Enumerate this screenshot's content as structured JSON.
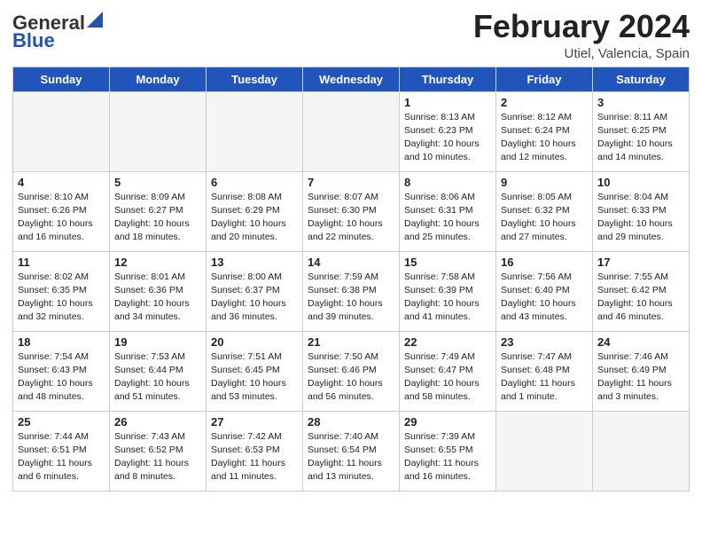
{
  "header": {
    "logo_general": "General",
    "logo_blue": "Blue",
    "title": "February 2024",
    "subtitle": "Utiel, Valencia, Spain"
  },
  "days_of_week": [
    "Sunday",
    "Monday",
    "Tuesday",
    "Wednesday",
    "Thursday",
    "Friday",
    "Saturday"
  ],
  "weeks": [
    [
      {
        "day": "",
        "info": ""
      },
      {
        "day": "",
        "info": ""
      },
      {
        "day": "",
        "info": ""
      },
      {
        "day": "",
        "info": ""
      },
      {
        "day": "1",
        "info": "Sunrise: 8:13 AM\nSunset: 6:23 PM\nDaylight: 10 hours and 10 minutes."
      },
      {
        "day": "2",
        "info": "Sunrise: 8:12 AM\nSunset: 6:24 PM\nDaylight: 10 hours and 12 minutes."
      },
      {
        "day": "3",
        "info": "Sunrise: 8:11 AM\nSunset: 6:25 PM\nDaylight: 10 hours and 14 minutes."
      }
    ],
    [
      {
        "day": "4",
        "info": "Sunrise: 8:10 AM\nSunset: 6:26 PM\nDaylight: 10 hours and 16 minutes."
      },
      {
        "day": "5",
        "info": "Sunrise: 8:09 AM\nSunset: 6:27 PM\nDaylight: 10 hours and 18 minutes."
      },
      {
        "day": "6",
        "info": "Sunrise: 8:08 AM\nSunset: 6:29 PM\nDaylight: 10 hours and 20 minutes."
      },
      {
        "day": "7",
        "info": "Sunrise: 8:07 AM\nSunset: 6:30 PM\nDaylight: 10 hours and 22 minutes."
      },
      {
        "day": "8",
        "info": "Sunrise: 8:06 AM\nSunset: 6:31 PM\nDaylight: 10 hours and 25 minutes."
      },
      {
        "day": "9",
        "info": "Sunrise: 8:05 AM\nSunset: 6:32 PM\nDaylight: 10 hours and 27 minutes."
      },
      {
        "day": "10",
        "info": "Sunrise: 8:04 AM\nSunset: 6:33 PM\nDaylight: 10 hours and 29 minutes."
      }
    ],
    [
      {
        "day": "11",
        "info": "Sunrise: 8:02 AM\nSunset: 6:35 PM\nDaylight: 10 hours and 32 minutes."
      },
      {
        "day": "12",
        "info": "Sunrise: 8:01 AM\nSunset: 6:36 PM\nDaylight: 10 hours and 34 minutes."
      },
      {
        "day": "13",
        "info": "Sunrise: 8:00 AM\nSunset: 6:37 PM\nDaylight: 10 hours and 36 minutes."
      },
      {
        "day": "14",
        "info": "Sunrise: 7:59 AM\nSunset: 6:38 PM\nDaylight: 10 hours and 39 minutes."
      },
      {
        "day": "15",
        "info": "Sunrise: 7:58 AM\nSunset: 6:39 PM\nDaylight: 10 hours and 41 minutes."
      },
      {
        "day": "16",
        "info": "Sunrise: 7:56 AM\nSunset: 6:40 PM\nDaylight: 10 hours and 43 minutes."
      },
      {
        "day": "17",
        "info": "Sunrise: 7:55 AM\nSunset: 6:42 PM\nDaylight: 10 hours and 46 minutes."
      }
    ],
    [
      {
        "day": "18",
        "info": "Sunrise: 7:54 AM\nSunset: 6:43 PM\nDaylight: 10 hours and 48 minutes."
      },
      {
        "day": "19",
        "info": "Sunrise: 7:53 AM\nSunset: 6:44 PM\nDaylight: 10 hours and 51 minutes."
      },
      {
        "day": "20",
        "info": "Sunrise: 7:51 AM\nSunset: 6:45 PM\nDaylight: 10 hours and 53 minutes."
      },
      {
        "day": "21",
        "info": "Sunrise: 7:50 AM\nSunset: 6:46 PM\nDaylight: 10 hours and 56 minutes."
      },
      {
        "day": "22",
        "info": "Sunrise: 7:49 AM\nSunset: 6:47 PM\nDaylight: 10 hours and 58 minutes."
      },
      {
        "day": "23",
        "info": "Sunrise: 7:47 AM\nSunset: 6:48 PM\nDaylight: 11 hours and 1 minute."
      },
      {
        "day": "24",
        "info": "Sunrise: 7:46 AM\nSunset: 6:49 PM\nDaylight: 11 hours and 3 minutes."
      }
    ],
    [
      {
        "day": "25",
        "info": "Sunrise: 7:44 AM\nSunset: 6:51 PM\nDaylight: 11 hours and 6 minutes."
      },
      {
        "day": "26",
        "info": "Sunrise: 7:43 AM\nSunset: 6:52 PM\nDaylight: 11 hours and 8 minutes."
      },
      {
        "day": "27",
        "info": "Sunrise: 7:42 AM\nSunset: 6:53 PM\nDaylight: 11 hours and 11 minutes."
      },
      {
        "day": "28",
        "info": "Sunrise: 7:40 AM\nSunset: 6:54 PM\nDaylight: 11 hours and 13 minutes."
      },
      {
        "day": "29",
        "info": "Sunrise: 7:39 AM\nSunset: 6:55 PM\nDaylight: 11 hours and 16 minutes."
      },
      {
        "day": "",
        "info": ""
      },
      {
        "day": "",
        "info": ""
      }
    ]
  ]
}
